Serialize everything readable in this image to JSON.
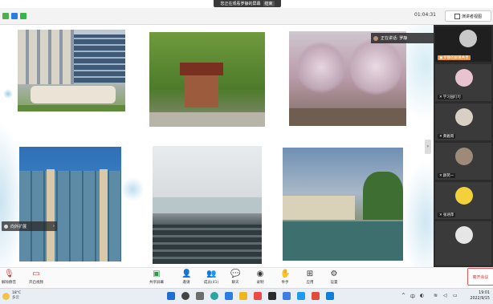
{
  "share_banner": {
    "text": "您正在观看罗静的屏幕",
    "stop_label": "结束"
  },
  "topbar": {
    "timer": "01:04:31",
    "view_label": "演讲者视图"
  },
  "speaking": {
    "text": "正在讲话: 罗静"
  },
  "participants": [
    {
      "name": "罗静的屏幕共享"
    },
    {
      "name": "学习园叮叮"
    },
    {
      "name": "黄雅雨"
    },
    {
      "name": "颜苑一"
    },
    {
      "name": "张涵萍"
    },
    {
      "name": ""
    }
  ],
  "thumb_label": {
    "text": "向外扩展"
  },
  "toolbar": {
    "mute": "解除静音",
    "video": "开启视频",
    "share": "共享屏幕",
    "invite": "邀请",
    "members": "成员(41)",
    "chat": "聊天",
    "record": "录制",
    "hand": "举手",
    "apps": "应用",
    "settings": "设置",
    "leave": "离开会议"
  },
  "taskbar": {
    "weather_temp": "18°C",
    "weather_desc": "多云",
    "ime": "中",
    "time": "19:01",
    "date": "2022/9/15"
  },
  "colors": {
    "accent": "#e55353",
    "panel": "#2c2c2c"
  }
}
